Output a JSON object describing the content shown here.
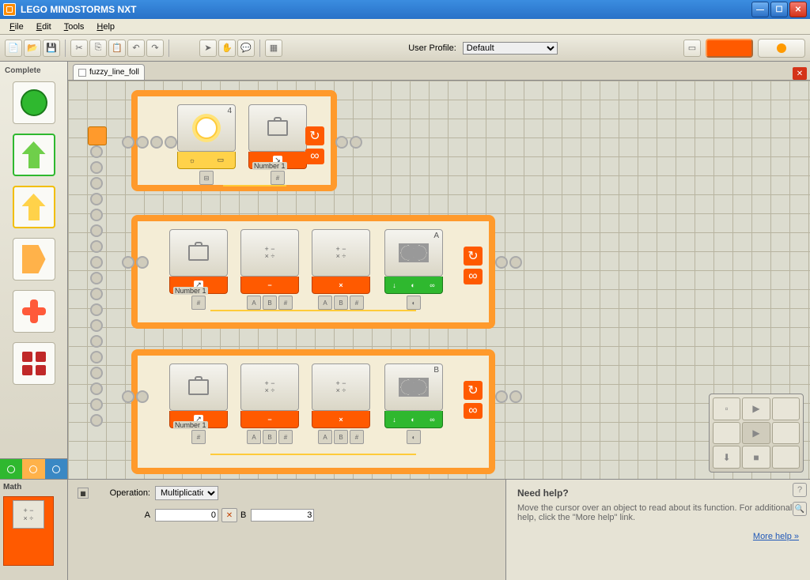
{
  "window": {
    "title": "LEGO MINDSTORMS NXT"
  },
  "menu": {
    "file": "File",
    "edit": "Edit",
    "tools": "Tools",
    "help": "Help"
  },
  "toolbar": {
    "userProfileLabel": "User Profile:",
    "profiles": [
      "Default"
    ],
    "selectedProfile": "Default"
  },
  "palette": {
    "header": "Complete"
  },
  "tab": {
    "name": "fuzzy_line_foll"
  },
  "blocks": {
    "sensorPort": "4",
    "numberRead1": "Number 1",
    "numberRead2": "Number 1",
    "numberRead3": "Number 1",
    "motorA": "A",
    "motorB": "B",
    "hubHash": "#",
    "hubA": "A",
    "hubB": "B",
    "loopInfinity": "∞"
  },
  "config": {
    "panelTitle": "Math",
    "operationLabel": "Operation:",
    "operations": [
      "Multiplication"
    ],
    "selectedOperation": "Multiplication",
    "aLabel": "A",
    "aValue": "0",
    "bLabel": "B",
    "bValue": "3"
  },
  "help": {
    "title": "Need help?",
    "body": "Move the cursor over an object to read about its function. For additional help, click the \"More help\" link.",
    "linkText": "More help »"
  }
}
